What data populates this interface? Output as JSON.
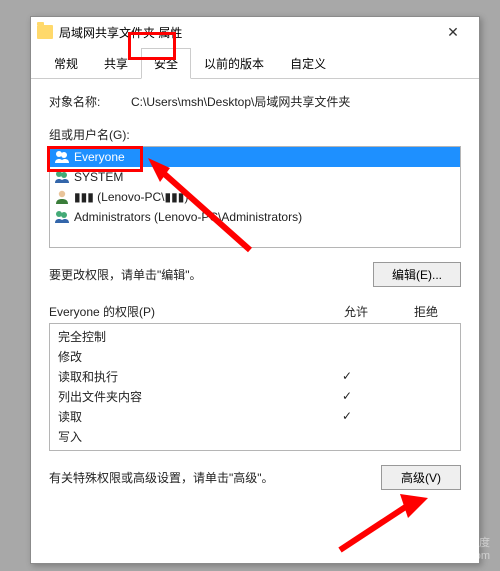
{
  "title": "局域网共享文件夹 属性",
  "tabs": [
    "常规",
    "共享",
    "安全",
    "以前的版本",
    "自定义"
  ],
  "active_tab_index": 2,
  "object_label": "对象名称:",
  "object_value": "C:\\Users\\msh\\Desktop\\局域网共享文件夹",
  "group_label": "组或用户名(G):",
  "groups": [
    {
      "name": "Everyone",
      "selected": true
    },
    {
      "name": "SYSTEM",
      "selected": false
    },
    {
      "name": "▮▮▮ (Lenovo-PC\\▮▮▮)",
      "selected": false
    },
    {
      "name": "Administrators (Lenovo-PC\\Administrators)",
      "selected": false
    }
  ],
  "edit_hint": "要更改权限，请单击\"编辑\"。",
  "edit_btn": "编辑(E)...",
  "perm_header_label": "Everyone 的权限(P)",
  "perm_allow": "允许",
  "perm_deny": "拒绝",
  "permissions": [
    {
      "name": "完全控制",
      "allow": false,
      "deny": false
    },
    {
      "name": "修改",
      "allow": false,
      "deny": false
    },
    {
      "name": "读取和执行",
      "allow": true,
      "deny": false
    },
    {
      "name": "列出文件夹内容",
      "allow": true,
      "deny": false
    },
    {
      "name": "读取",
      "allow": true,
      "deny": false
    },
    {
      "name": "写入",
      "allow": false,
      "deny": false
    }
  ],
  "adv_hint": "有关特殊权限或高级设置，请单击\"高级\"。",
  "adv_btn": "高级(V)",
  "watermark1": "Bai❀百度",
  "watermark2": "jingyan.baidu.com"
}
